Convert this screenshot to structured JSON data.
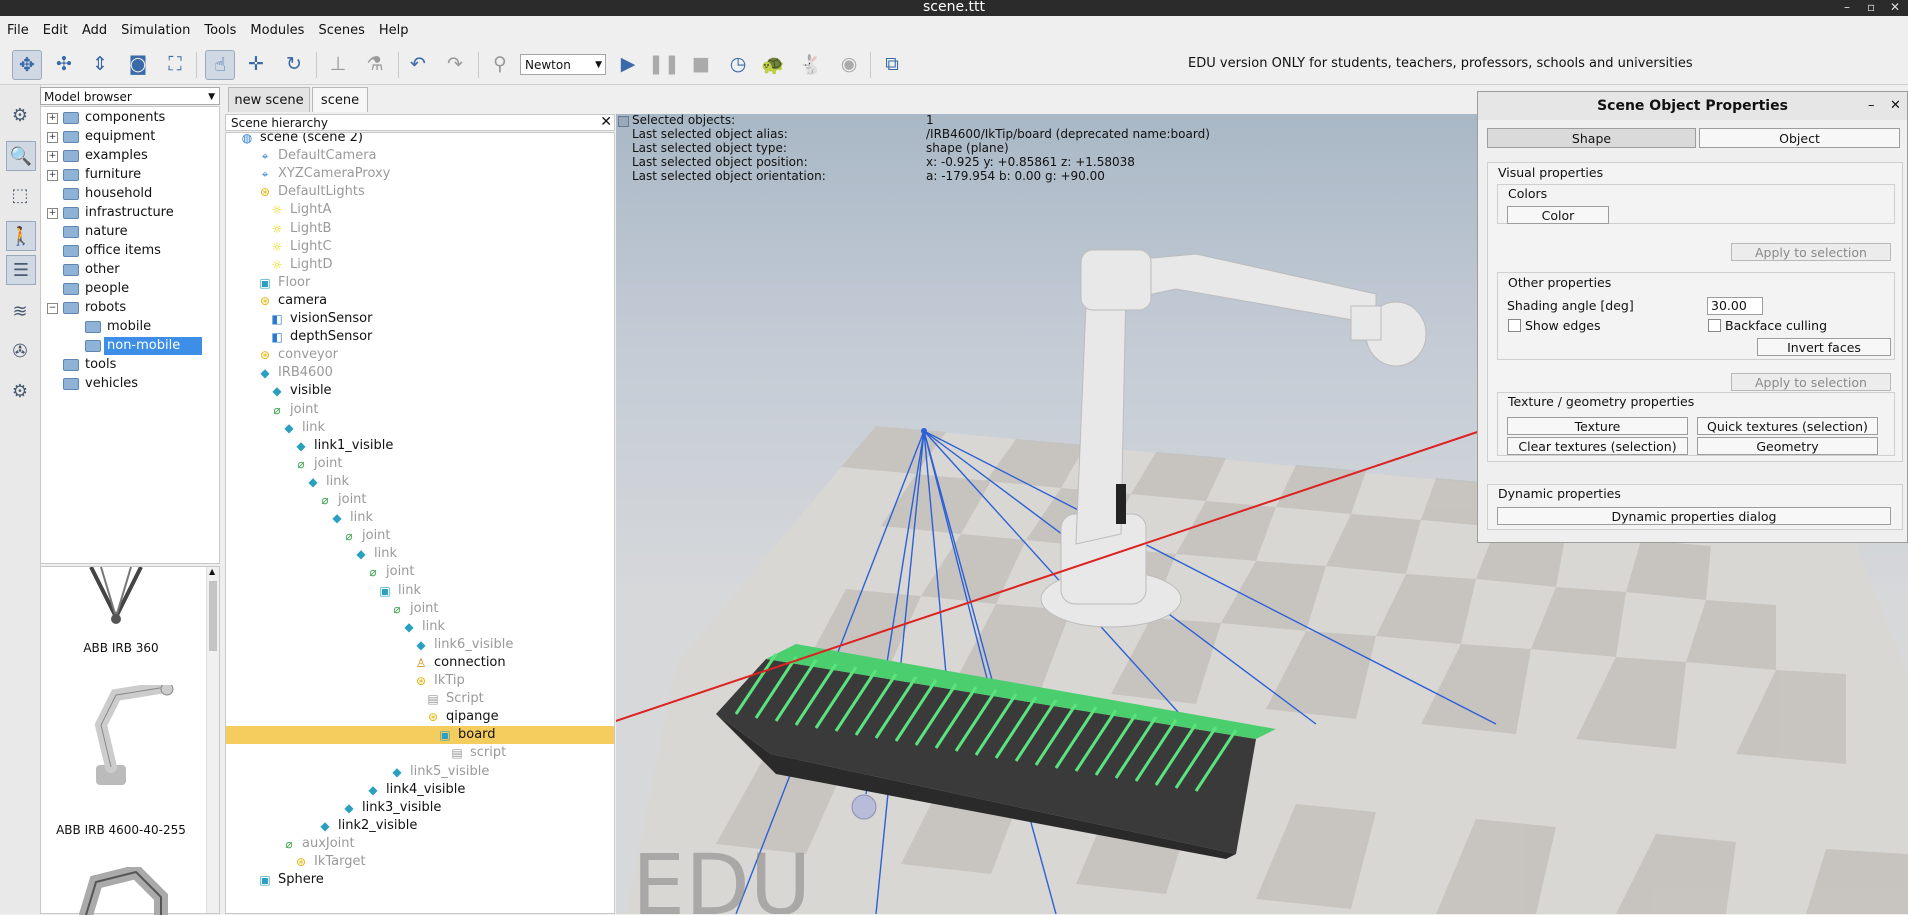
{
  "window": {
    "title": "scene.ttt",
    "minimize": "–",
    "maximize": "▫",
    "close": "✕"
  },
  "menu": [
    "File",
    "Edit",
    "Add",
    "Simulation",
    "Tools",
    "Modules",
    "Scenes",
    "Help"
  ],
  "toolbar": {
    "engine_selected": "Newton",
    "edu_notice": "EDU version ONLY for students, teachers, professors, schools and universities"
  },
  "model_browser": {
    "header": "Model browser",
    "folders": [
      "components",
      "equipment",
      "examples",
      "furniture",
      "household",
      "infrastructure",
      "nature",
      "office items",
      "other",
      "people",
      "robots",
      "mobile",
      "non-mobile",
      "tools",
      "vehicles"
    ],
    "thumbnails": [
      "ABB IRB 360",
      "ABB IRB 4600-40-255"
    ]
  },
  "tabs": [
    "new scene",
    "scene"
  ],
  "hierarchy": {
    "header": "Scene hierarchy",
    "close": "✕",
    "items": [
      "scene (scene 2)",
      "DefaultCamera",
      "XYZCameraProxy",
      "DefaultLights",
      "LightA",
      "LightB",
      "LightC",
      "LightD",
      "Floor",
      "camera",
      "visionSensor",
      "depthSensor",
      "conveyor",
      "IRB4600",
      "visible",
      "joint",
      "link",
      "link1_visible",
      "joint",
      "link",
      "joint",
      "link",
      "joint",
      "link",
      "joint",
      "link",
      "joint",
      "link",
      "link6_visible",
      "connection",
      "IkTip",
      "Script",
      "qipange",
      "board",
      "script",
      "link5_visible",
      "link4_visible",
      "link3_visible",
      "link2_visible",
      "auxJoint",
      "IkTarget",
      "Sphere"
    ]
  },
  "info": {
    "rows": [
      {
        "k": "Selected objects:",
        "v": "1"
      },
      {
        "k": "Last selected object alias:",
        "v": "/IRB4600/IkTip/board    (deprecated name:board)"
      },
      {
        "k": "Last selected object type:",
        "v": "shape (plane)"
      },
      {
        "k": "Last selected object position:",
        "v": "x: -0.925    y: +0.85861    z: +1.58038"
      },
      {
        "k": "Last selected object orientation:",
        "v": "a: -179.954    b: 0.00    g: +90.00"
      }
    ]
  },
  "viewport_watermark": "EDU",
  "properties": {
    "title": "Scene Object Properties",
    "tab_shape": "Shape",
    "tab_object": "Object",
    "visual": "Visual properties",
    "colors": "Colors",
    "color_btn": "Color",
    "apply1": "Apply to selection",
    "other": "Other properties",
    "shading_label": "Shading angle [deg]",
    "shading_value": "30.00",
    "show_edges": "Show edges",
    "backface": "Backface culling",
    "invert": "Invert faces",
    "apply2": "Apply to selection",
    "texture_group": "Texture / geometry properties",
    "texture": "Texture",
    "quick_textures": "Quick textures (selection)",
    "clear_textures": "Clear textures (selection)",
    "geometry": "Geometry",
    "dynamic": "Dynamic properties",
    "dynamic_dialog": "Dynamic properties dialog"
  }
}
